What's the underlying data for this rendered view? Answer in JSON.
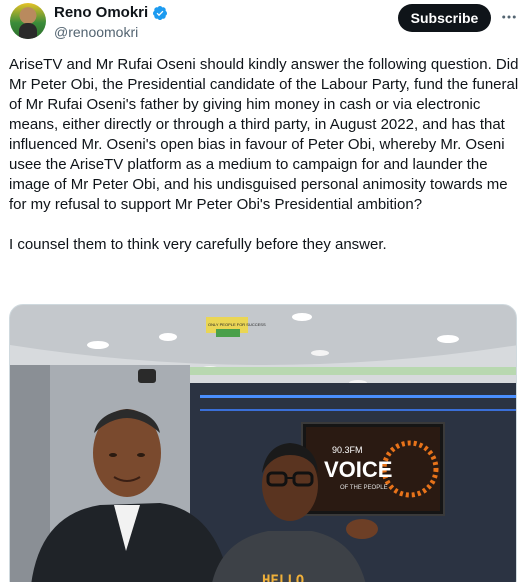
{
  "author": {
    "display_name": "Reno Omokri",
    "handle": "@renoomokri",
    "verified": true,
    "verified_color": "#1d9bf0"
  },
  "actions": {
    "subscribe_label": "Subscribe",
    "more_icon": "more-icon"
  },
  "tweet": {
    "paragraphs": [
      "AriseTV and Mr Rufai Oseni should kindly answer the following question. Did Mr Peter Obi, the Presidential candidate of the Labour Party, fund the funeral of Mr Rufai Oseni's father by giving him money in cash or via electronic means, either directly or through a third party, in August 2022, and has that influenced Mr. Oseni's open bias in favour of Peter Obi, whereby Mr. Oseni usee the AriseTV platform as a medium to campaign for and launder the image of Mr Peter Obi, and his undisguised personal animosity towards me for my refusal to support Mr Peter Obi's Presidential ambition?",
      "I counsel them to think very carefully before they answer."
    ]
  },
  "media": {
    "screen_brand_top": "90.3FM",
    "screen_brand_main": "VOICE",
    "screen_brand_sub": "OF THE PEOPLE",
    "shirt_text": "HELLO",
    "watermark_text": "ONLY PEOPLE FOR SUCCESS"
  }
}
